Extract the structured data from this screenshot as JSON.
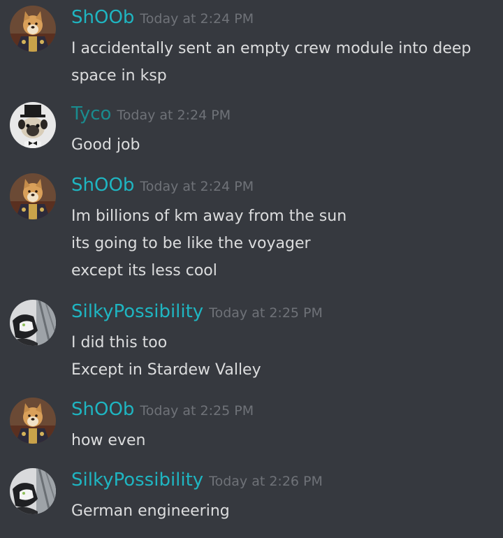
{
  "messages": [
    {
      "author": "ShOOb",
      "timestamp": "Today at 2:24 PM",
      "avatar_icon": "shiba-general-avatar",
      "lines": [
        "I accidentally sent an empty crew module into deep",
        "space in ksp"
      ]
    },
    {
      "author": "Tyco",
      "timestamp": "Today at 2:24 PM",
      "avatar_icon": "pug-tophat-avatar",
      "lines": [
        "Good job"
      ]
    },
    {
      "author": "ShOOb",
      "timestamp": "Today at 2:24 PM",
      "avatar_icon": "shiba-general-avatar",
      "lines": [
        "Im billions of km away from the sun",
        "its going to be like the voyager",
        "except its less cool"
      ]
    },
    {
      "author": "SilkyPossibility",
      "timestamp": "Today at 2:25 PM",
      "avatar_icon": "cat-window-avatar",
      "lines": [
        "I did this too",
        "Except in Stardew Valley"
      ]
    },
    {
      "author": "ShOOb",
      "timestamp": "Today at 2:25 PM",
      "avatar_icon": "shiba-general-avatar",
      "lines": [
        "how even"
      ]
    },
    {
      "author": "SilkyPossibility",
      "timestamp": "Today at 2:26 PM",
      "avatar_icon": "cat-window-avatar",
      "lines": [
        "German engineering"
      ]
    }
  ],
  "colors": {
    "background": "#36393f",
    "username_teal": "#1fb5c1",
    "username_dark_teal": "#1a8b8e",
    "timestamp": "#6f7278",
    "message_text": "#dcddde"
  }
}
